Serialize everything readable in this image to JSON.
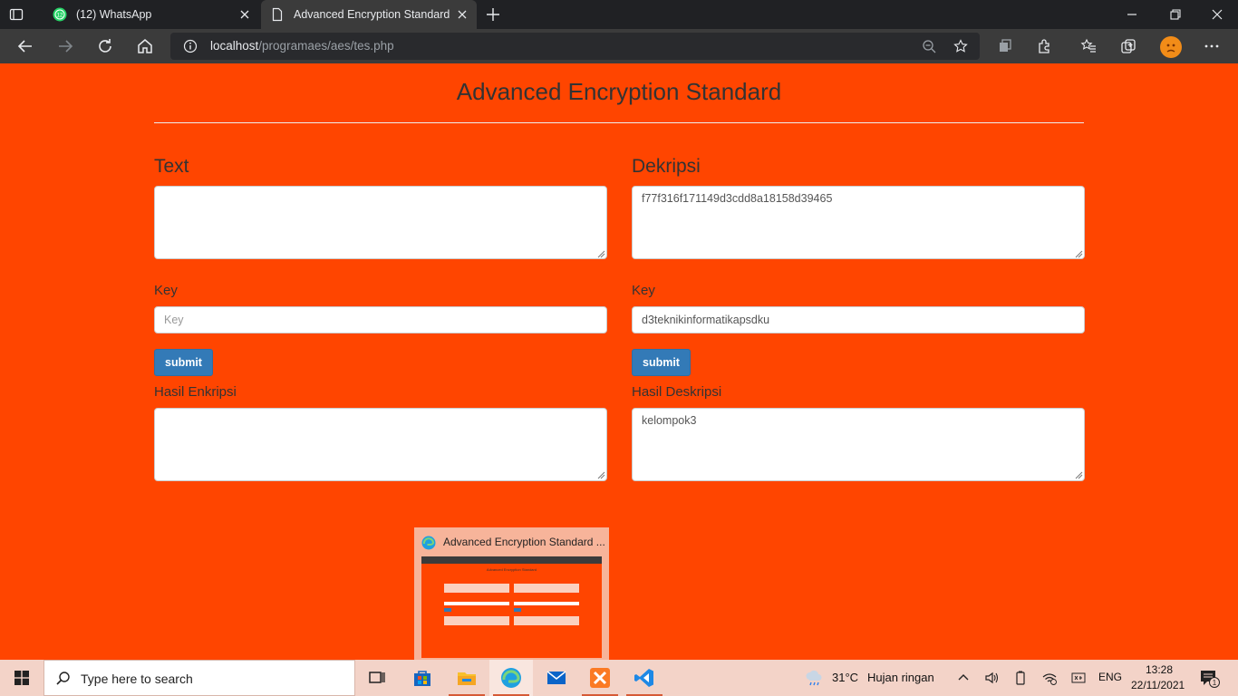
{
  "browser": {
    "tabs": [
      {
        "title": "(12) WhatsApp",
        "badge": "12"
      },
      {
        "title": "Advanced Encryption Standard"
      }
    ],
    "url_host": "localhost",
    "url_path": "/programaes/aes/tes.php"
  },
  "page": {
    "title": "Advanced Encryption Standard",
    "encrypt": {
      "heading": "Text",
      "text_value": "",
      "key_label": "Key",
      "key_placeholder": "Key",
      "key_value": "",
      "submit_label": "submit",
      "result_label": "Hasil Enkripsi",
      "result_value": ""
    },
    "decrypt": {
      "heading": "Dekripsi",
      "text_value": "f77f316f171149d3cdd8a18158d39465",
      "key_label": "Key",
      "key_value": "d3teknikinformatikapsdku",
      "submit_label": "submit",
      "result_label": "Hasil Deskripsi",
      "result_value": "kelompok3"
    }
  },
  "preview": {
    "title": "Advanced Encryption Standard ...",
    "mini_title": "Advanced Encryption Standard"
  },
  "taskbar": {
    "search_placeholder": "Type here to search",
    "weather_temp": "31°C",
    "weather_desc": "Hujan ringan",
    "language": "ENG",
    "time": "13:28",
    "date": "22/11/2021",
    "notification_count": "1"
  },
  "colors": {
    "page_bg": "#ff4500",
    "button": "#337ab7",
    "taskbar": "#f3d3c8"
  }
}
